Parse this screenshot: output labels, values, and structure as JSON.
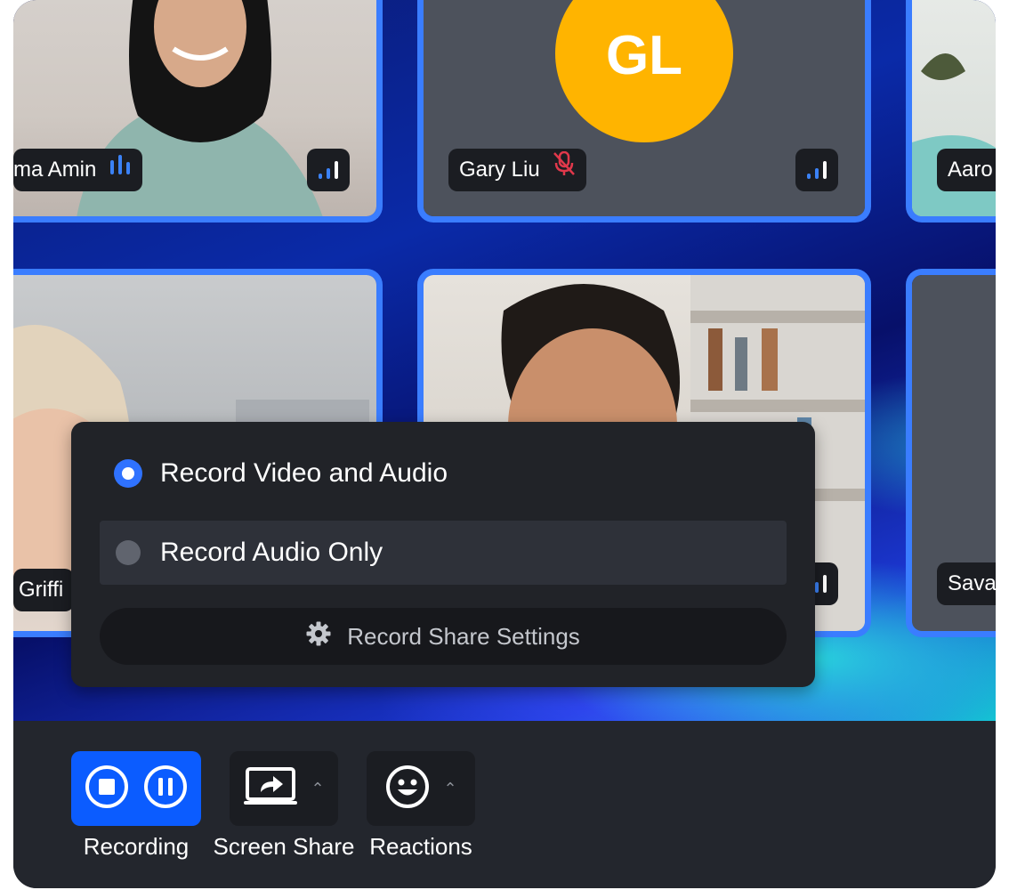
{
  "participants": [
    {
      "name": "ma Amin",
      "initials": ""
    },
    {
      "name": "Gary Liu",
      "initials": "GL"
    },
    {
      "name": "Aaro",
      "initials": ""
    },
    {
      "name": "Griffi",
      "initials": ""
    },
    {
      "name": "",
      "initials": ""
    },
    {
      "name": "Sava",
      "initials": ""
    }
  ],
  "record_menu": {
    "option_video_audio": "Record Video and Audio",
    "option_audio_only": "Record Audio Only",
    "selected": "option_video_audio",
    "share_settings_label": "Record Share Settings"
  },
  "toolbar": {
    "recording_label": "Recording",
    "screen_share_label": "Screen Share",
    "reactions_label": "Reactions"
  },
  "colors": {
    "accent": "#0b5cff",
    "tile_border": "#3a7dff",
    "avatar": "#ffb400",
    "muted": "#e0384b"
  },
  "icons": [
    "signal-icon",
    "audio-level-icon",
    "mic-muted-icon",
    "gear-icon",
    "stop-icon",
    "pause-icon",
    "screen-share-icon",
    "smile-icon",
    "chevron-up-icon"
  ]
}
